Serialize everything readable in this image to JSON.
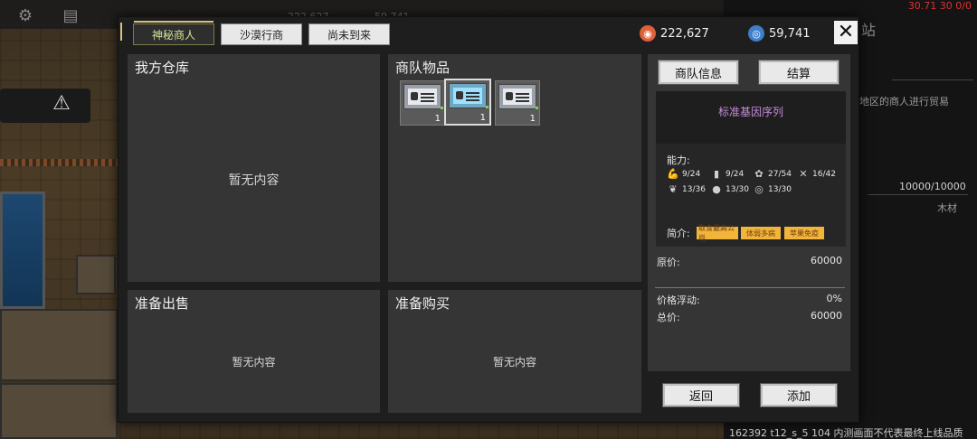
{
  "background": {
    "top_resource_a": "222,627",
    "top_resource_b": "59,741",
    "side_text_1": "站",
    "side_text_2": "地区的商人进行贸易",
    "side_text_3": "10000/10000",
    "side_text_4": "木材"
  },
  "hud": {
    "coords": "30.71 30 0/0",
    "build_info": "162392 t12_s_5 104  内测画面不代表最终上线品质"
  },
  "tabs": [
    {
      "label": "神秘商人",
      "active": true
    },
    {
      "label": "沙漠行商",
      "active": false
    },
    {
      "label": "尚未到来",
      "active": false
    }
  ],
  "resources": {
    "copper": "222,627",
    "silver": "59,741"
  },
  "panels": {
    "my_storage": {
      "title": "我方仓库",
      "empty": "暂无内容"
    },
    "caravan_items": {
      "title": "商队物品"
    },
    "ready_sell": {
      "title": "准备出售",
      "empty": "暂无内容"
    },
    "ready_buy": {
      "title": "准备购买",
      "empty": "暂无内容"
    }
  },
  "caravan_items": [
    {
      "count": "1",
      "selected": false
    },
    {
      "count": "1",
      "selected": true
    },
    {
      "count": "1",
      "selected": false
    }
  ],
  "side": {
    "info_button": "商队信息",
    "settle_button": "结算",
    "item_name": "标准基因序列",
    "ability_label": "能力:",
    "abilities": [
      {
        "icon": "arm-icon",
        "value": "9/24"
      },
      {
        "icon": "block-icon",
        "value": "9/24"
      },
      {
        "icon": "paw-icon",
        "value": "27/54"
      },
      {
        "icon": "tools-icon",
        "value": "16/42"
      },
      {
        "icon": "leaf-icon",
        "value": "13/36"
      },
      {
        "icon": "head-icon",
        "value": "13/30"
      },
      {
        "icon": "target-icon",
        "value": "13/30"
      }
    ],
    "intro_label": "简介:",
    "tags": [
      "取食最高公尚",
      "体弱多病",
      "苹果免疫"
    ],
    "original_price_label": "原价:",
    "original_price": "60000",
    "fluctuation_label": "价格浮动:",
    "fluctuation": "0%",
    "total_label": "总价:",
    "total": "60000",
    "back_button": "返回",
    "add_button": "添加"
  },
  "colors": {
    "active_tab_text": "#d7e59a",
    "item_name": "#c58bd8",
    "tag_bg": "#f2b53a",
    "copper_icon": "#e0603a",
    "silver_icon": "#3f7fc8"
  }
}
